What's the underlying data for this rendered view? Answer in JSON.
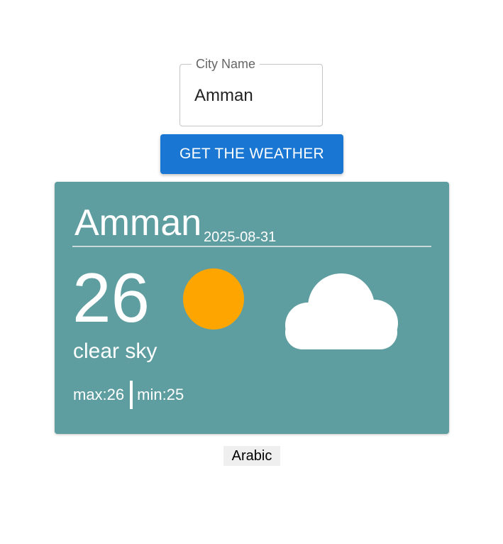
{
  "search": {
    "label": "City Name",
    "value": "Amman",
    "button_label": "GET THE WEATHER"
  },
  "weather_card": {
    "city": "Amman",
    "date": "2025-08-31",
    "temperature": "26",
    "description": "clear sky",
    "max": "max:26",
    "min": "min:25",
    "background_color": "#5f9ea0",
    "icons": [
      "sun-icon",
      "cloud-icon"
    ]
  },
  "language_toggle": {
    "label": "Arabic"
  },
  "colors": {
    "button": "#1976d2",
    "sun": "#ffa500",
    "card": "#5f9ea0"
  }
}
